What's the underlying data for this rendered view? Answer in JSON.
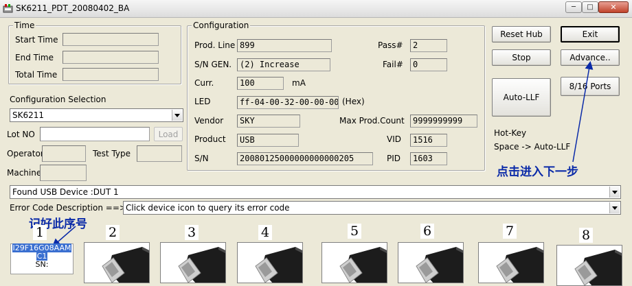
{
  "window": {
    "title": "SK6211_PDT_20080402_BA"
  },
  "time_group": {
    "legend": "Time",
    "start_label": "Start Time",
    "end_label": "End Time",
    "total_label": "Total Time",
    "start_value": "",
    "end_value": "",
    "total_value": ""
  },
  "config_selection": {
    "label": "Configuration Selection",
    "value": "SK6211"
  },
  "lot": {
    "label": "Lot NO",
    "value": "",
    "load_label": "Load"
  },
  "operator": {
    "label": "Operator",
    "value": ""
  },
  "test_type": {
    "label": "Test Type",
    "value": ""
  },
  "machine": {
    "label": "Machine",
    "value": ""
  },
  "configuration": {
    "legend": "Configuration",
    "prod_line_label": "Prod. Line",
    "prod_line": "899",
    "sn_gen_label": "S/N GEN.",
    "sn_gen": "(2) Increase",
    "curr_label": "Curr.",
    "curr": "100",
    "curr_unit": "mA",
    "led_label": "LED",
    "led": "ff-04-00-32-00-00-00",
    "led_unit": "(Hex)",
    "vendor_label": "Vendor",
    "vendor": "SKY",
    "product_label": "Product",
    "product": "USB",
    "sn_label": "S/N",
    "sn": "20080125000000000000205",
    "pass_label": "Pass#",
    "pass": "2",
    "fail_label": "Fail#",
    "fail": "0",
    "max_prod_label": "Max Prod.Count",
    "max_prod": "9999999999",
    "vid_label": "VID",
    "vid": "1516",
    "pid_label": "PID",
    "pid": "1603"
  },
  "buttons": {
    "reset_hub": "Reset Hub",
    "exit": "Exit",
    "stop": "Stop",
    "advance": "Advance..",
    "auto_llf": "Auto-LLF",
    "ports": "8/16 Ports"
  },
  "hotkey": {
    "title": "Hot-Key",
    "text": "Space -> Auto-LLF"
  },
  "annotations": {
    "next_step": "点击进入下一步",
    "remember_serial": "记好此序号"
  },
  "status": {
    "found_device": "Found USB Device :DUT 1",
    "error_code_label": "Error Code Description ==>",
    "error_code_value": "Click device icon to query its error code"
  },
  "ports": [
    {
      "number": "1"
    },
    {
      "number": "2"
    },
    {
      "number": "3"
    },
    {
      "number": "4"
    },
    {
      "number": "5"
    },
    {
      "number": "6"
    },
    {
      "number": "7"
    },
    {
      "number": "8"
    }
  ],
  "device": {
    "chip_line1": "I29F16G08AAM",
    "chip_line2": "C1",
    "sn_label": "SN:"
  },
  "colors": {
    "annotation": "#0a2aa8",
    "selection": "#3a6fd0",
    "window_bg": "#ece9d8"
  }
}
